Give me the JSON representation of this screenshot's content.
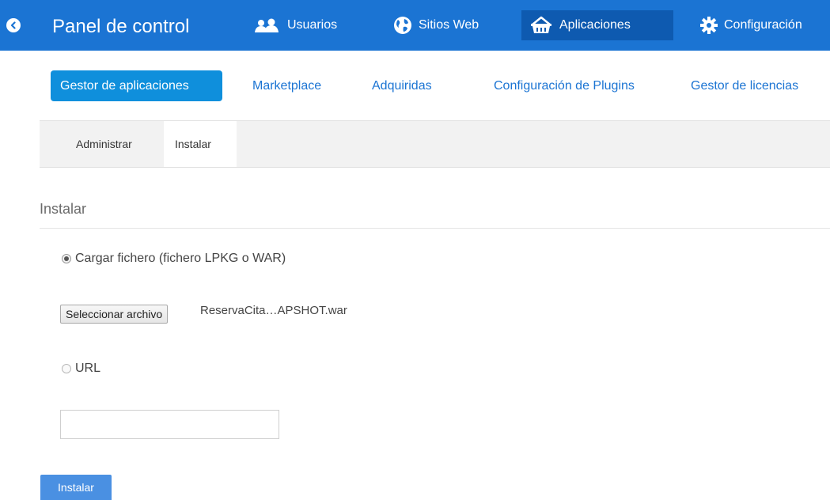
{
  "header": {
    "title": "Panel de control",
    "back_icon": "back-arrow-icon",
    "nav": [
      {
        "label": "Usuarios",
        "icon": "users-icon"
      },
      {
        "label": "Sitios Web",
        "icon": "globe-icon"
      },
      {
        "label": "Aplicaciones",
        "icon": "basket-icon",
        "active": true
      },
      {
        "label": "Configuración",
        "icon": "gear-icon"
      }
    ]
  },
  "app_tabs": [
    {
      "label": "Gestor de aplicaciones",
      "active": true
    },
    {
      "label": "Marketplace"
    },
    {
      "label": "Adquiridas"
    },
    {
      "label": "Configuración de Plugins"
    },
    {
      "label": "Gestor de licencias"
    }
  ],
  "sub_tabs": [
    {
      "label": "Administrar"
    },
    {
      "label": "Instalar",
      "active": true
    }
  ],
  "install": {
    "section_title": "Instalar",
    "upload_option_label": "Cargar fichero (fichero LPKG o WAR)",
    "upload_selected": true,
    "file_button_label": "Seleccionar archivo",
    "file_name": "ReservaCita…APSHOT.war",
    "url_option_label": "URL",
    "url_value": "",
    "submit_label": "Instalar"
  },
  "colors": {
    "topbar": "#1b74d3",
    "active_nav": "#0e5ab0",
    "active_tab": "#0f8fdc",
    "install_button": "#4a90e2"
  }
}
